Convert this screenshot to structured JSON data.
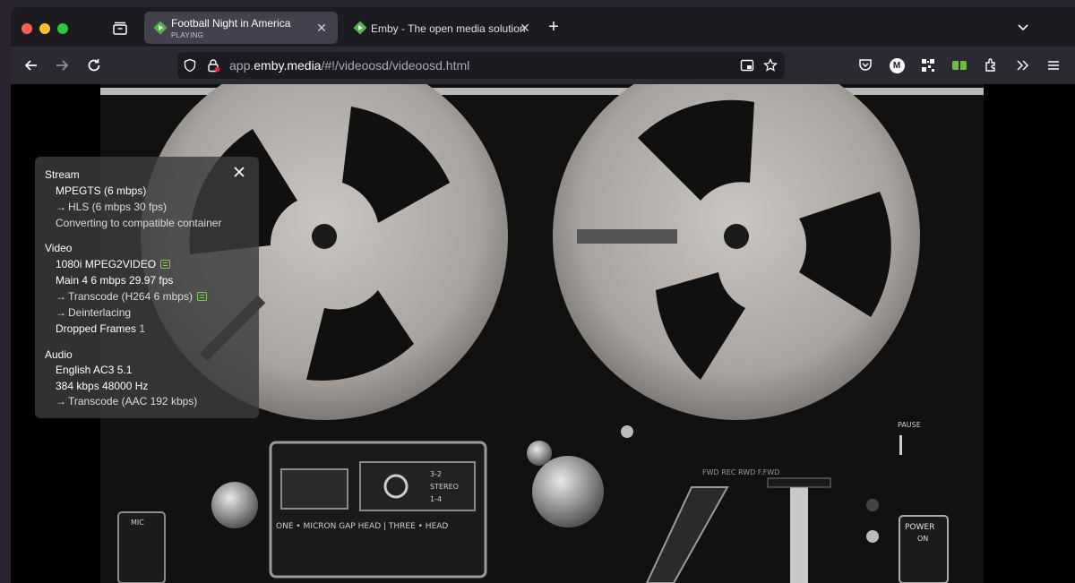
{
  "browser": {
    "tabs": [
      {
        "title": "Football Night in America",
        "subtitle": "PLAYING",
        "active": true
      },
      {
        "title": "Emby - The open media solution",
        "active": false
      }
    ],
    "new_tab_label": "+",
    "url": {
      "domain_prefix": "app.",
      "domain": "emby.media",
      "path": "/#!/videoosd/videoosd.html"
    },
    "toolbar_icons": [
      "pocket-icon",
      "account-m-icon",
      "qr-extension-icon",
      "green-extension-icon",
      "extensions-icon",
      "overflow-icon",
      "menu-icon"
    ],
    "account_initial": "M"
  },
  "stats": {
    "stream": {
      "title": "Stream",
      "container": "MPEGTS (6 mbps)",
      "hls": "HLS (6 mbps 30 fps)",
      "converting": "Converting to compatible container"
    },
    "video": {
      "title": "Video",
      "codec": "1080i MPEG2VIDEO",
      "profile": "Main 4 6 mbps 29.97 fps",
      "transcode": "Transcode (H264 6 mbps)",
      "deinterlacing": "Deinterlacing",
      "dropped_label": "Dropped Frames",
      "dropped_value": "1"
    },
    "audio": {
      "title": "Audio",
      "codec": "English AC3 5.1",
      "bitrate": "384 kbps 48000 Hz",
      "transcode": "Transcode (AAC 192 kbps)"
    }
  },
  "video_labels": {
    "head": "ONE • MICRON GAP HEAD | THREE • HEAD",
    "mode1": "3-2",
    "mode2": "STEREO",
    "mode3": "1-4",
    "pause": "PAUSE",
    "power": "POWER",
    "power_state": "ON",
    "mic": "MIC",
    "transport": "FWD  REC  RWD   F.FWD"
  },
  "colors": {
    "accent_green": "#52b54b",
    "badge_green": "#7bd04a"
  }
}
